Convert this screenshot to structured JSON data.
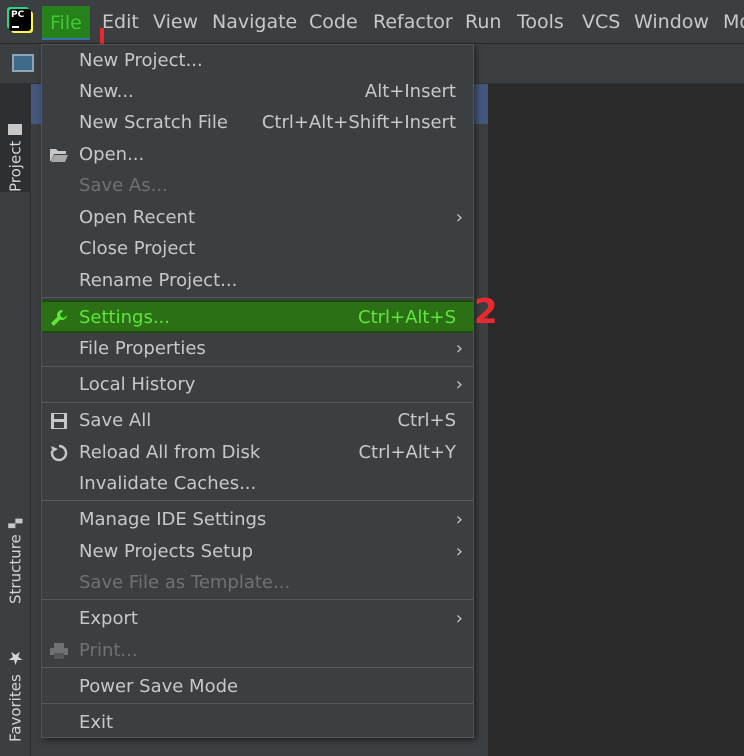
{
  "menubar": {
    "logo_text": "PC",
    "items": [
      "File",
      "Edit",
      "View",
      "Navigate",
      "Code",
      "Refactor",
      "Run",
      "Tools",
      "VCS",
      "Window",
      "Mo"
    ]
  },
  "left_strip": {
    "project_tab": "Project",
    "structure_tab": "Structure",
    "favorites_tab": "Favorites"
  },
  "file_menu": {
    "new_project": "New Project...",
    "new": "New...",
    "new_shortcut": "Alt+Insert",
    "new_scratch": "New Scratch File",
    "new_scratch_shortcut": "Ctrl+Alt+Shift+Insert",
    "open": "Open...",
    "save_as": "Save As...",
    "open_recent": "Open Recent",
    "close_project": "Close Project",
    "rename_project": "Rename Project...",
    "settings": "Settings...",
    "settings_shortcut": "Ctrl+Alt+S",
    "file_properties": "File Properties",
    "local_history": "Local History",
    "save_all": "Save All",
    "save_all_shortcut": "Ctrl+S",
    "reload_all": "Reload All from Disk",
    "reload_all_shortcut": "Ctrl+Alt+Y",
    "invalidate_caches": "Invalidate Caches...",
    "manage_ide_settings": "Manage IDE Settings",
    "new_projects_setup": "New Projects Setup",
    "save_file_as_template": "Save File as Template...",
    "export": "Export",
    "print": "Print...",
    "power_save_mode": "Power Save Mode",
    "exit": "Exit"
  },
  "annotations": {
    "mark_2": "2"
  },
  "colors": {
    "menu_bg": "#3c3f41",
    "selected_bg": "#2c7016",
    "selected_text": "#5fe63c",
    "annotation_red": "#e8292e"
  }
}
